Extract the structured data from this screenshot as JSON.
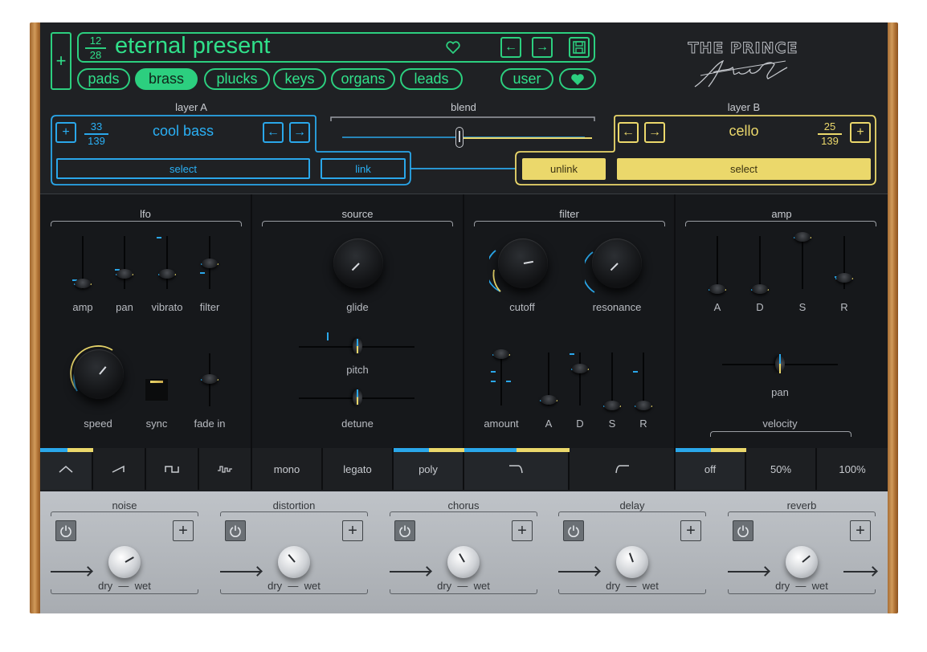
{
  "preset": {
    "index": "12",
    "total": "28",
    "name": "eternal present",
    "add_label": "+",
    "prev": "←",
    "next": "→"
  },
  "categories": [
    "pads",
    "brass",
    "plucks",
    "keys",
    "organs",
    "leads",
    "user"
  ],
  "active_category": "brass",
  "brand": {
    "title": "THE PRINCE",
    "signature": "Frank Dukes"
  },
  "layer_a": {
    "label": "layer A",
    "index": "33",
    "total": "139",
    "name": "cool bass",
    "select": "select",
    "link": "link"
  },
  "blend": {
    "label": "blend",
    "value": 0.5
  },
  "layer_b": {
    "label": "layer B",
    "index": "25",
    "total": "139",
    "name": "cello",
    "unlink": "unlink",
    "select": "select"
  },
  "lfo": {
    "title": "lfo",
    "faders": [
      "amp",
      "pan",
      "vibrato",
      "filter"
    ],
    "speed": "speed",
    "sync": "sync",
    "fade_in": "fade in",
    "waves": [
      "sine-wave-icon",
      "saw-wave-icon",
      "square-wave-icon",
      "random-wave-icon"
    ]
  },
  "source": {
    "title": "source",
    "glide": "glide",
    "pitch": "pitch",
    "detune": "detune",
    "modes": [
      "mono",
      "legato",
      "poly"
    ]
  },
  "filter": {
    "title": "filter",
    "cutoff": "cutoff",
    "resonance": "resonance",
    "amount": "amount",
    "env": [
      "A",
      "D",
      "S",
      "R"
    ],
    "types": [
      "lowpass-icon",
      "highpass-icon"
    ]
  },
  "amp": {
    "title": "amp",
    "env": [
      "A",
      "D",
      "S",
      "R"
    ],
    "pan": "pan",
    "velocity": "velocity",
    "velocity_opts": [
      "off",
      "50%",
      "100%"
    ]
  },
  "fx": [
    {
      "name": "noise",
      "dry": "dry",
      "sep": "—",
      "wet": "wet"
    },
    {
      "name": "distortion",
      "dry": "dry",
      "sep": "—",
      "wet": "wet"
    },
    {
      "name": "chorus",
      "dry": "dry",
      "sep": "—",
      "wet": "wet"
    },
    {
      "name": "delay",
      "dry": "dry",
      "sep": "—",
      "wet": "wet"
    },
    {
      "name": "reverb",
      "dry": "dry",
      "sep": "—",
      "wet": "wet"
    }
  ],
  "colors": {
    "green": "#2ccf7f",
    "blue": "#2aa7ea",
    "yellow": "#ebd86b"
  }
}
